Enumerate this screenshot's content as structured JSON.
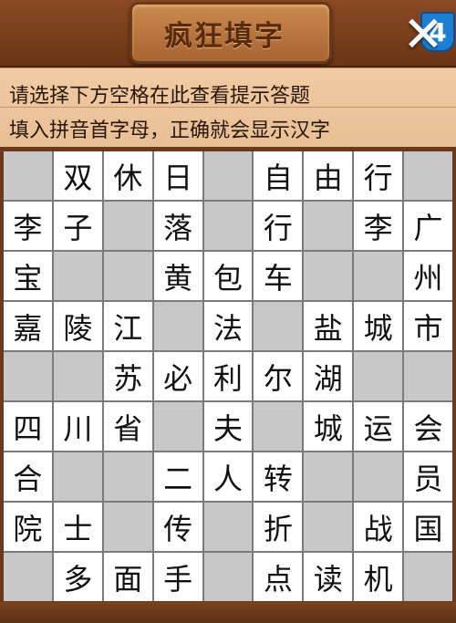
{
  "header": {
    "title": "疯狂填字",
    "level_badge": "4",
    "close_icon": "close-icon"
  },
  "hints": {
    "line1": "请选择下方空格在此查看提示答题",
    "line2": "填入拼音首字母，正确就会显示汉字"
  },
  "board": {
    "rows": [
      [
        "",
        "双",
        "休",
        "日",
        "",
        "自",
        "由",
        "行",
        ""
      ],
      [
        "李",
        "子",
        "",
        "落",
        "",
        "行",
        "",
        "李",
        "广"
      ],
      [
        "宝",
        "",
        "",
        "黄",
        "包",
        "车",
        "",
        "",
        "州"
      ],
      [
        "嘉",
        "陵",
        "江",
        "",
        "法",
        "",
        "盐",
        "城",
        "市"
      ],
      [
        "",
        "",
        "苏",
        "必",
        "利",
        "尔",
        "湖",
        "",
        ""
      ],
      [
        "四",
        "川",
        "省",
        "",
        "夫",
        "",
        "城",
        "运",
        "会"
      ],
      [
        "合",
        "",
        "",
        "二",
        "人",
        "转",
        "",
        "",
        "员"
      ],
      [
        "院",
        "士",
        "",
        "传",
        "",
        "折",
        "",
        "战",
        "国"
      ],
      [
        "",
        "多",
        "面",
        "手",
        "",
        "点",
        "读",
        "机",
        ""
      ]
    ]
  },
  "colors": {
    "wood": "#6b3a1c",
    "hint_bg": "#f0cba4",
    "blank_cell": "#c8c8c8",
    "badge": "#1d7fd4"
  }
}
